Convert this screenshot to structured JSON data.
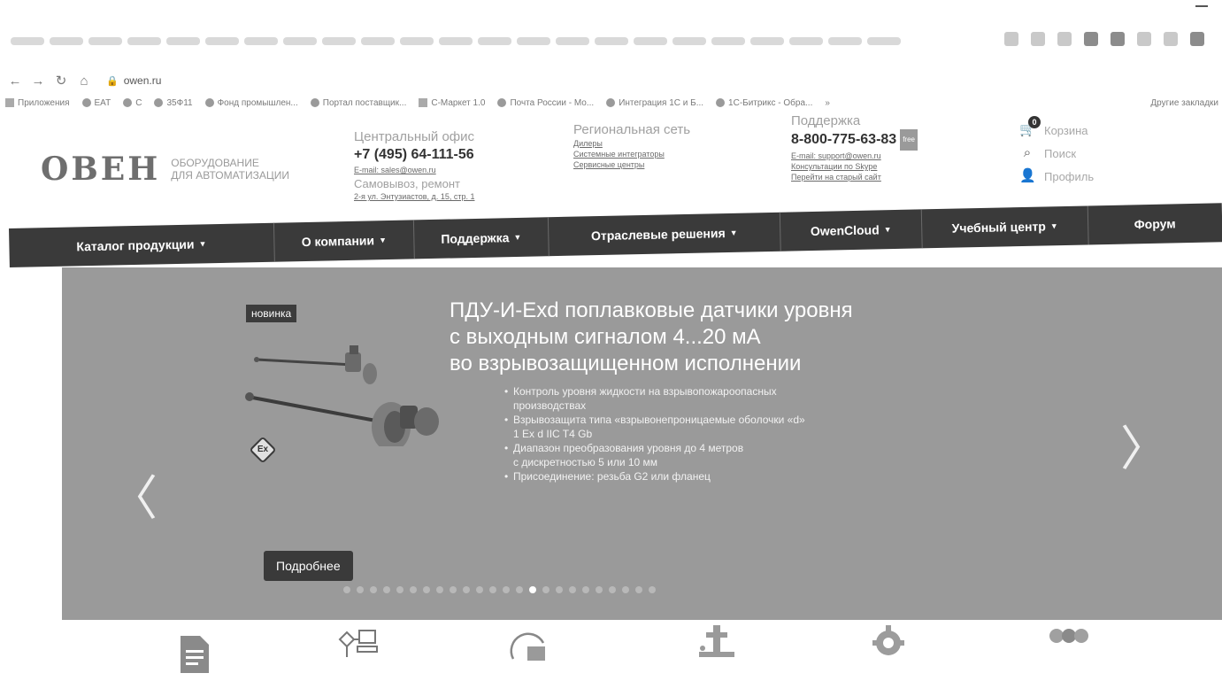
{
  "browser": {
    "url": "owen.ru",
    "bookmarks": [
      {
        "label": "Приложения"
      },
      {
        "label": "EAT"
      },
      {
        "label": "С"
      },
      {
        "label": "35Ф11"
      },
      {
        "label": "Фонд промышлен..."
      },
      {
        "label": "Портал поставщик..."
      },
      {
        "label": "С-Маркет 1.0"
      },
      {
        "label": "Почта России - Мо..."
      },
      {
        "label": "Интеграция 1С и Б..."
      },
      {
        "label": "1С-Битрикс - Обра..."
      },
      {
        "label": "»"
      }
    ],
    "other_bookmarks": "Другие закладки"
  },
  "header": {
    "logo_text": "ОВЕН",
    "logo_tagline_1": "ОБОРУДОВАНИЕ",
    "logo_tagline_2": "ДЛЯ АВТОМАТИЗАЦИИ",
    "office": {
      "title": "Центральный офис",
      "phone": "+7 (495) 64-111-56",
      "email": "E-mail: sales@owen.ru",
      "pickup": "Самовывоз, ремонт",
      "address": "2-я ул. Энтузиастов, д. 15, стр. 1"
    },
    "region": {
      "title": "Региональная сеть",
      "links": [
        "Дилеры",
        "Системные интеграторы",
        "Сервисные центры"
      ]
    },
    "support": {
      "title": "Поддержка",
      "phone": "8-800-775-63-83",
      "badge": "free",
      "links": [
        "E-mail: support@owen.ru",
        "Консультации по Skype",
        "Перейти на старый сайт"
      ]
    },
    "user": {
      "cart_label": "Корзина",
      "cart_count": "0",
      "search_label": "Поиск",
      "profile_label": "Профиль"
    }
  },
  "nav": {
    "items": [
      {
        "label": "Каталог продукции"
      },
      {
        "label": "О компании"
      },
      {
        "label": "Поддержка"
      },
      {
        "label": "Отраслевые решения"
      },
      {
        "label": "OwenCloud"
      },
      {
        "label": "Учебный центр"
      },
      {
        "label": "Форум"
      }
    ]
  },
  "banner": {
    "badge": "новинка",
    "title_1": "ПДУ-И-Exd поплавковые датчики уровня",
    "title_2": "с выходным сигналом 4...20 мА",
    "title_3": "во взрывозащищенном исполнении",
    "bullets": [
      {
        "line1": "Контроль уровня жидкости на взрывопожароопасных",
        "line2": "производствах"
      },
      {
        "line1": "Взрывозащита типа «взрывонепроницаемые оболочки «d»",
        "line2": "1 Ex d IIC T4 Gb"
      },
      {
        "line1": "Диапазон преобразования уровня до 4 метров",
        "line2": "с дискретностью 5 или 10 мм"
      },
      {
        "line1": "Присоединение: резьба G2 или фланец",
        "line2": ""
      }
    ],
    "ex_label": "Ex",
    "button": "Подробнее",
    "arrow_left": "〈",
    "arrow_right": "〉",
    "slide_count": 24,
    "active_slide": 14
  }
}
